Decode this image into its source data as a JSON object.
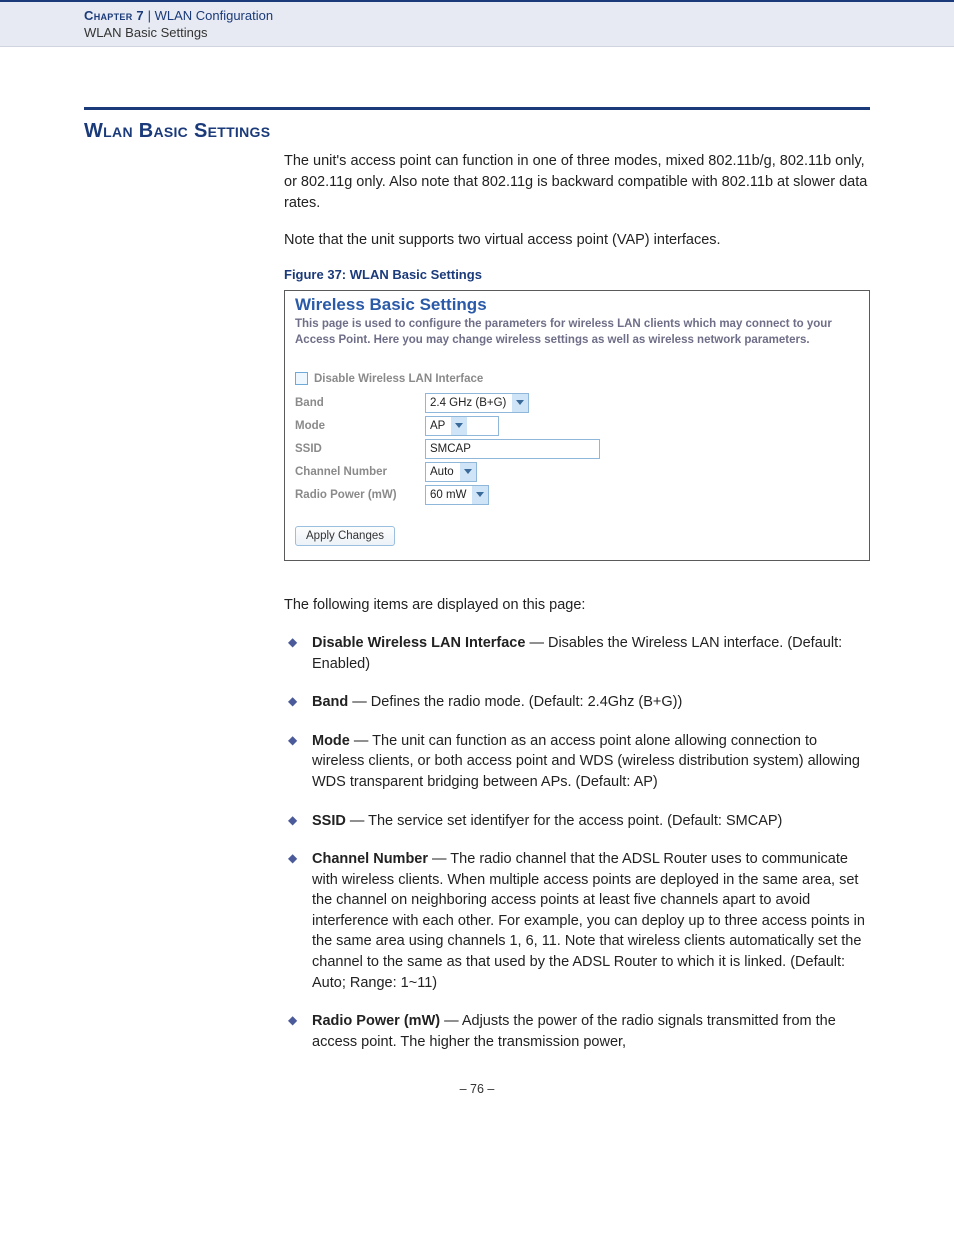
{
  "header": {
    "chapter_label": "Chapter 7",
    "separator": "|",
    "chapter_title": "WLAN Configuration",
    "subtitle": "WLAN Basic Settings"
  },
  "section_heading": "Wlan Basic Settings",
  "intro_para_1": "The unit's access point can function in one of three modes, mixed 802.11b/g, 802.11b only, or 802.11g only. Also note that 802.11g is backward compatible with 802.11b at slower data rates.",
  "intro_para_2": "Note that the unit supports two virtual access point (VAP) interfaces.",
  "figure_caption": "Figure 37:  WLAN Basic Settings",
  "figure": {
    "title": "Wireless Basic Settings",
    "description": "This page is used to configure the parameters for wireless LAN clients which may connect to your Access Point. Here you may change wireless settings as well as wireless network parameters.",
    "disable_label": "Disable Wireless LAN Interface",
    "rows": {
      "band": {
        "label": "Band",
        "value": "2.4 GHz (B+G)"
      },
      "mode": {
        "label": "Mode",
        "value": "AP"
      },
      "ssid": {
        "label": "SSID",
        "value": "SMCAP"
      },
      "channel": {
        "label": "Channel Number",
        "value": "Auto"
      },
      "power": {
        "label": "Radio Power (mW)",
        "value": "60 mW"
      }
    },
    "apply_label": "Apply Changes"
  },
  "items_intro": "The following items are displayed on this page:",
  "items": [
    {
      "term": "Disable Wireless LAN Interface",
      "desc": " — Disables the Wireless LAN interface. (Default: Enabled)"
    },
    {
      "term": "Band",
      "desc": " — Defines the radio mode. (Default: 2.4Ghz (B+G))"
    },
    {
      "term": "Mode",
      "desc": " — The unit can function as an access point alone allowing connection to wireless clients, or both access point and WDS (wireless distribution system) allowing WDS transparent bridging between APs. (Default: AP)"
    },
    {
      "term": "SSID",
      "desc": " — The service set identifyer for the access point. (Default: SMCAP)"
    },
    {
      "term": "Channel Number",
      "desc": " — The radio channel that the ADSL Router uses to communicate with wireless clients. When multiple access points are deployed in the same area, set the channel on neighboring access points at least five channels apart to avoid interference with each other. For example, you can deploy up to three access points in the same area using channels 1, 6, 11. Note that wireless clients automatically set the channel to the same as that used by the ADSL Router to which it is linked. (Default: Auto; Range: 1~11)"
    },
    {
      "term": "Radio Power (mW)",
      "desc": " — Adjusts the power of the radio signals transmitted from the access point. The higher the transmission power,"
    }
  ],
  "page_number": "– 76 –"
}
